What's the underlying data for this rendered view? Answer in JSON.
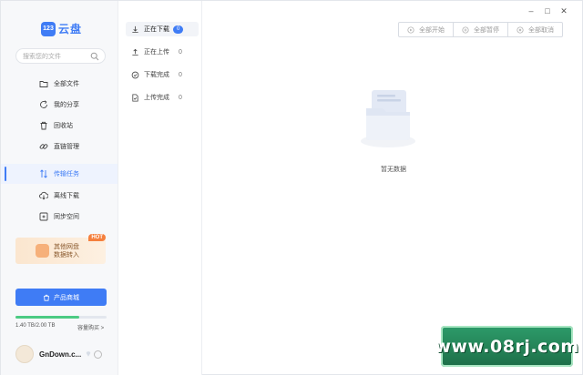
{
  "app": {
    "logo_badge": "123",
    "logo_text": "云盘"
  },
  "search": {
    "placeholder": "搜索您的文件"
  },
  "sidebar": {
    "items": [
      {
        "label": "全部文件",
        "icon": "folder-icon"
      },
      {
        "label": "我的分享",
        "icon": "share-icon"
      },
      {
        "label": "回收站",
        "icon": "trash-icon"
      },
      {
        "label": "直链管理",
        "icon": "link-icon"
      },
      {
        "label": "传输任务",
        "icon": "transfer-icon"
      },
      {
        "label": "离线下载",
        "icon": "cloud-download-icon"
      },
      {
        "label": "同步空间",
        "icon": "sync-icon"
      }
    ],
    "active_index": 4
  },
  "promo": {
    "line1": "其他网盘",
    "line2": "数据转入",
    "badge": "HOT"
  },
  "shop": {
    "label": "产品商城"
  },
  "storage": {
    "text": "1.40 TB/2.00 TB",
    "used_fraction": 0.7,
    "buy_label": "容量购买 >"
  },
  "user": {
    "name": "GnDown.c..."
  },
  "transfer": {
    "items": [
      {
        "label": "正在下载",
        "count": "0"
      },
      {
        "label": "正在上传",
        "count": "0"
      },
      {
        "label": "下载完成",
        "count": "0"
      },
      {
        "label": "上传完成",
        "count": "0"
      }
    ]
  },
  "window": {
    "minimize": "–",
    "maximize": "□",
    "close": "✕"
  },
  "actions": {
    "start_all": "全部开始",
    "pause_all": "全部暂停",
    "cancel_all": "全部取消"
  },
  "empty": {
    "text": "暂无数据"
  },
  "watermark": {
    "text": "www.08rj.com"
  },
  "colors": {
    "accent": "#3f7cf5",
    "storage": "#4ccb83",
    "hot": "#f5803e"
  }
}
